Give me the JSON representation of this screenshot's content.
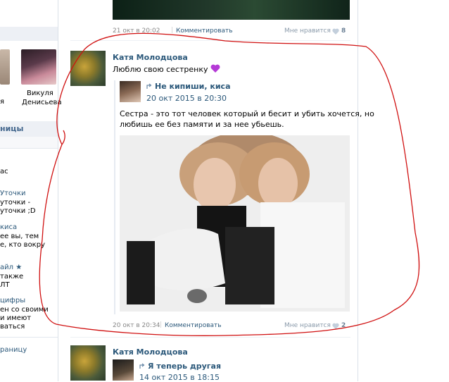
{
  "left": {
    "friends": [
      {
        "name_line1": "",
        "name_line2": "я"
      },
      {
        "name_line1": "Викуля",
        "name_line2": "Денисьева"
      }
    ],
    "section_title": "ницы",
    "items": [
      {
        "title": "",
        "desc": [
          "ас"
        ]
      },
      {
        "title": "Уточки",
        "desc": [
          "уточки -",
          "уточки ;D"
        ]
      },
      {
        "title": "киса",
        "desc": [
          "ее вы, тем",
          "е, кто вокру"
        ]
      },
      {
        "title": "айл ★",
        "desc": [
          "также",
          "ЛТ"
        ]
      },
      {
        "title": "цифры",
        "desc": [
          "ен со своими",
          "и имеют",
          "ваться"
        ]
      }
    ],
    "footer_link": "раницу"
  },
  "top_post": {
    "date": "21 окт в 20:02",
    "comment": "Комментировать",
    "like_label": "Мне нравится",
    "like_count": "8"
  },
  "post": {
    "author": "Катя Молодцова",
    "text": "Люблю свою сестренку",
    "repost": {
      "title": "Не кипиши, киса",
      "date": "20 окт 2015 в 20:30",
      "text_line1": "Сестра - это тот человек который и бесит и убить хочется, но",
      "text_line2": "любишь ее без памяти и за нее убьешь."
    },
    "date": "20 окт в 20:34",
    "comment": "Комментировать",
    "like_label": "Мне нравится",
    "like_count": "2"
  },
  "next_post": {
    "author": "Катя Молодцова",
    "repost_title": "Я теперь другая",
    "repost_date": "14 окт 2015 в 18:15"
  },
  "colors": {
    "link": "#2b587a",
    "annotation": "#d01010"
  }
}
